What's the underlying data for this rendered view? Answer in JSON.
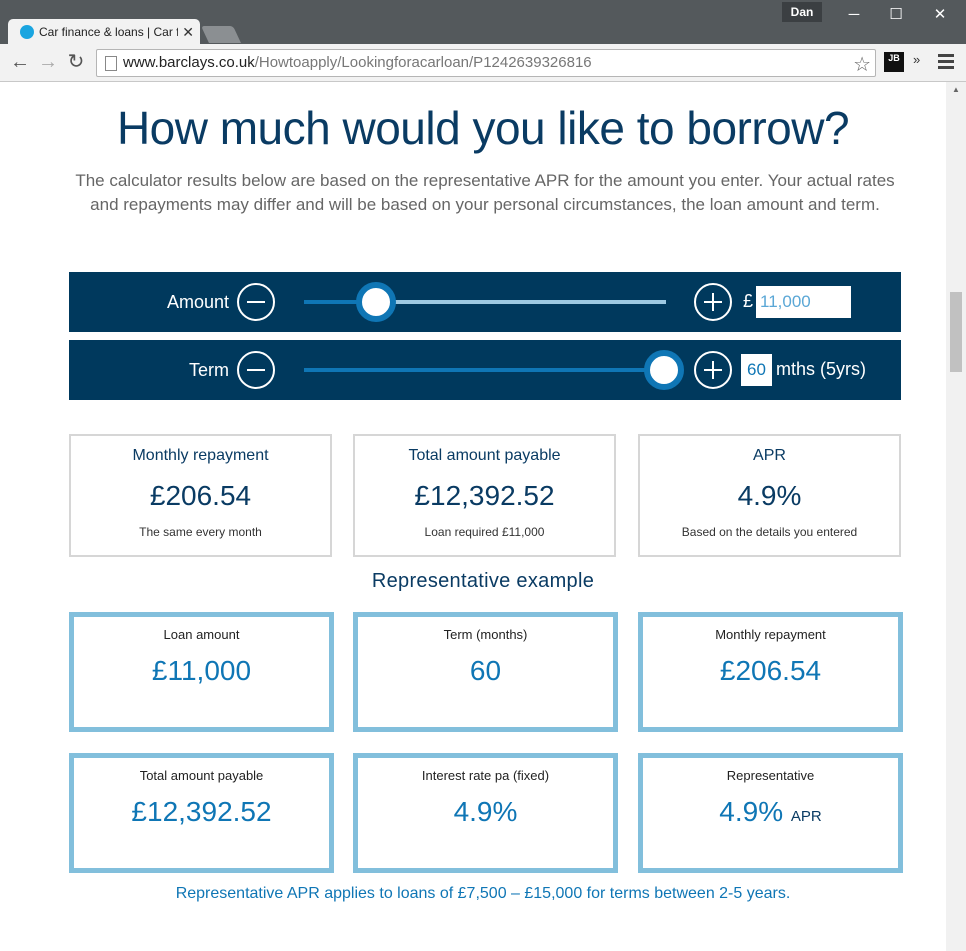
{
  "browser": {
    "tab_title": "Car finance & loans | Car f",
    "user": "Dan",
    "url_host": "www.barclays.co.uk",
    "url_path": "/Howtoapply/Lookingforacarloan/P1242639326816",
    "ext_label": "JB",
    "ext_more": "»"
  },
  "heading": "How much would you like to borrow?",
  "intro": "The calculator results below are based on the representative APR for the amount you enter. Your actual rates and repayments may differ and will be based on your personal circumstances, the loan amount and term.",
  "amount_slider": {
    "label": "Amount",
    "currency": "£",
    "value": "11,000",
    "level": 0.2
  },
  "term_slider": {
    "label": "Term",
    "value": "60",
    "unit": "mths (5yrs)",
    "level": 1.0
  },
  "results": [
    {
      "label": "Monthly repayment",
      "value": "£206.54",
      "note": "The same every month"
    },
    {
      "label": "Total amount payable",
      "value": "£12,392.52",
      "note": "Loan required £11,000"
    },
    {
      "label": "APR",
      "value": "4.9%",
      "note": "Based on the details you entered"
    }
  ],
  "representative": {
    "heading": "Representative example",
    "items": [
      {
        "label": "Loan amount",
        "value": "£11,000",
        "suffix": ""
      },
      {
        "label": "Term (months)",
        "value": "60",
        "suffix": ""
      },
      {
        "label": "Monthly repayment",
        "value": "£206.54",
        "suffix": ""
      },
      {
        "label": "Total amount payable",
        "value": "£12,392.52",
        "suffix": ""
      },
      {
        "label": "Interest rate pa (fixed)",
        "value": "4.9%",
        "suffix": ""
      },
      {
        "label": "Representative",
        "value": "4.9%",
        "suffix": "APR"
      }
    ],
    "footnote": "Representative APR applies to loans of £7,500 – £15,000 for terms between 2-5 years."
  },
  "colors": {
    "brand_navy": "#00395d",
    "brand_blue": "#0f76b5",
    "panel_border": "#82bfdc"
  }
}
